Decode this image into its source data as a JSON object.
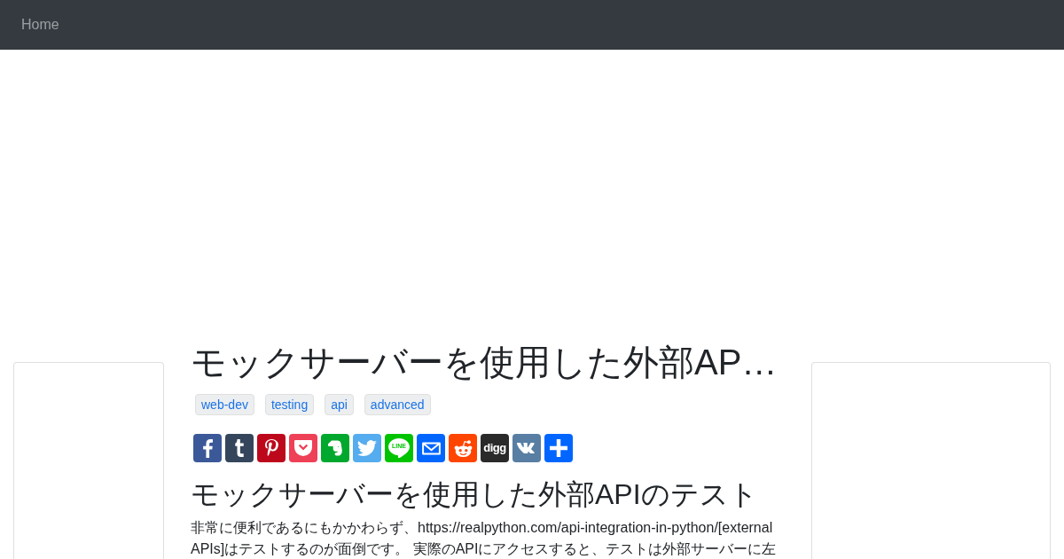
{
  "navbar": {
    "links": [
      {
        "label": "Home"
      }
    ]
  },
  "article": {
    "title": "モックサーバーを使用した外部AP…",
    "tags": [
      "web-dev",
      "testing",
      "api",
      "advanced"
    ],
    "share_buttons": [
      {
        "kind": "facebook",
        "color": "#3b5998"
      },
      {
        "kind": "tumblr",
        "color": "#35465c"
      },
      {
        "kind": "pinterest",
        "color": "#bd081c"
      },
      {
        "kind": "pocket",
        "color": "#ee4056"
      },
      {
        "kind": "evernote",
        "color": "#00a82d"
      },
      {
        "kind": "twitter",
        "color": "#55acee"
      },
      {
        "kind": "line",
        "color": "#00c300",
        "label": "LINE"
      },
      {
        "kind": "email",
        "color": "#0166ff"
      },
      {
        "kind": "reddit",
        "color": "#ff4500"
      },
      {
        "kind": "digg",
        "color": "#2a2a2a",
        "label": "digg"
      },
      {
        "kind": "vk",
        "color": "#587ea3"
      },
      {
        "kind": "share",
        "color": "#0166ff"
      }
    ],
    "heading": "モックサーバーを使用した外部APIのテスト",
    "paragraph": "非常に便利であるにもかかわらず、https://realpython.com/api-integration-in-python/[external APIs]はテストするのが面倒です。 実際のAPIにアクセスすると、テストは外部サーバーに左"
  }
}
